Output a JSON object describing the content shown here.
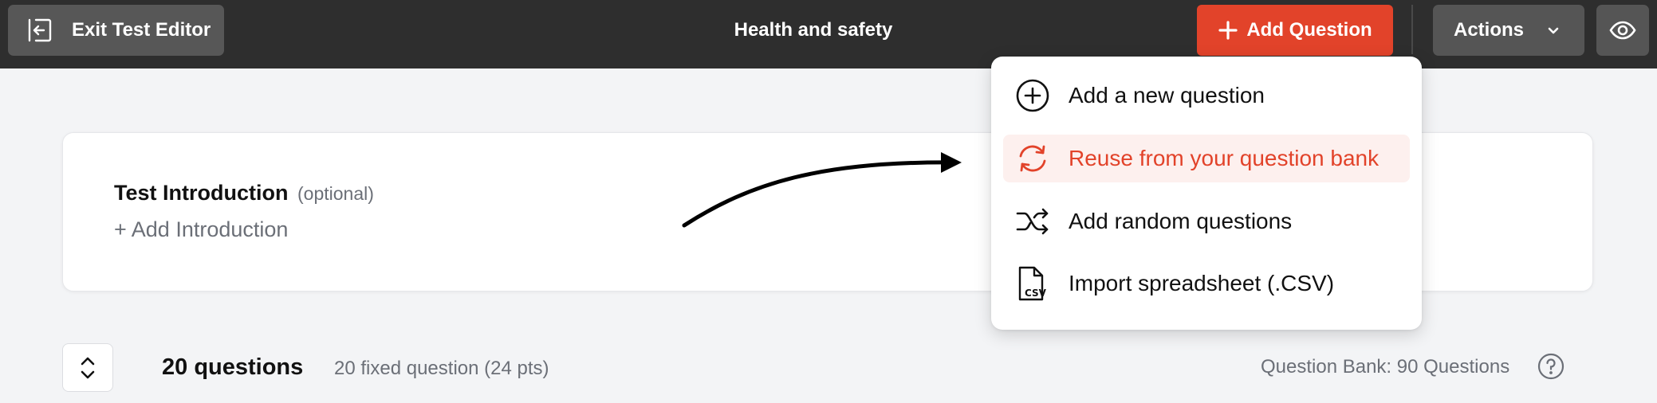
{
  "header": {
    "exit_label": "Exit Test Editor",
    "title": "Health and safety",
    "add_question_label": "Add Question",
    "actions_label": "Actions"
  },
  "intro": {
    "title": "Test Introduction",
    "optional": "(optional)",
    "add_label": "+ Add Introduction"
  },
  "dropdown": {
    "items": [
      {
        "label": "Add a new question",
        "icon": "plus-circle-icon"
      },
      {
        "label": "Reuse from your question bank",
        "icon": "refresh-icon"
      },
      {
        "label": "Add random questions",
        "icon": "shuffle-icon"
      },
      {
        "label": "Import spreadsheet (.CSV)",
        "icon": "csv-file-icon"
      }
    ],
    "active_index": 1
  },
  "summary": {
    "count": "20 questions",
    "fixed": "20 fixed question (24 pts)",
    "bank": "Question Bank: 90 Questions"
  },
  "colors": {
    "accent": "#e2432a",
    "topbar": "#2e2e2e",
    "button_gray": "#555555",
    "active_bg": "#fdf0ee"
  }
}
